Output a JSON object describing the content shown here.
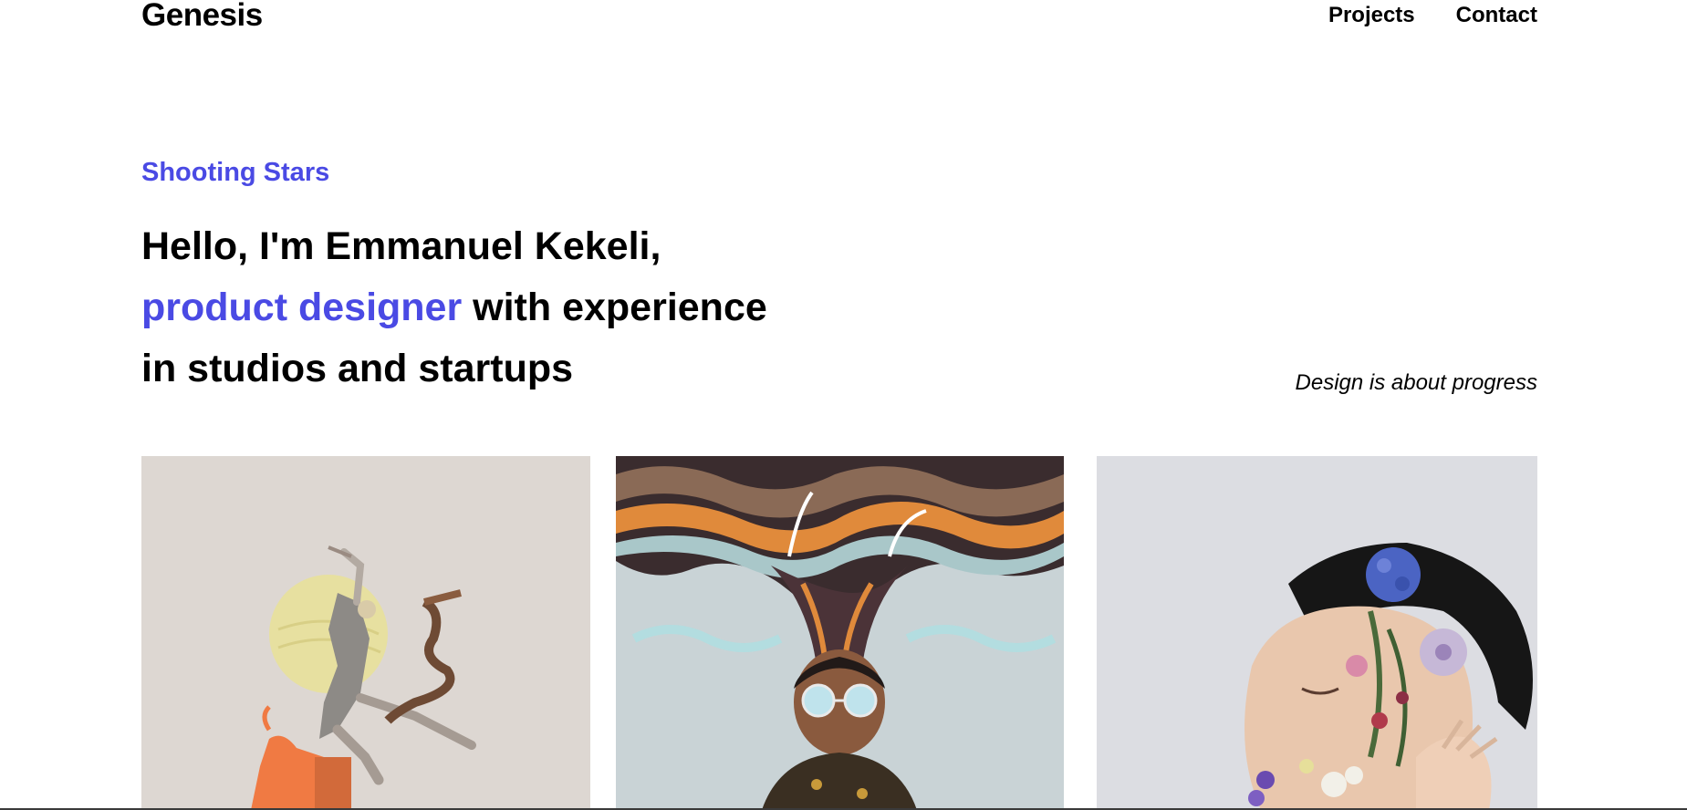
{
  "header": {
    "logo": "Genesis",
    "nav": [
      "Projects",
      "Contact"
    ]
  },
  "hero": {
    "kicker": "Shooting Stars",
    "line1": "Hello, I'm Emmanuel Kekeli,",
    "line2_accent": "product designer",
    "line2_rest": " with experience",
    "line3": "in studios and startups",
    "tagline": "Design is about progress"
  },
  "gallery": [
    {
      "icon": "dancer-collage-artwork",
      "bg": "#ddd7d2"
    },
    {
      "icon": "surreal-hair-waves-portrait",
      "bg": "#c8d2d6"
    },
    {
      "icon": "flower-face-portrait",
      "bg": "#dcdde2"
    }
  ],
  "colors": {
    "accent": "#4a4ae4",
    "text": "#000000",
    "background": "#ffffff"
  }
}
